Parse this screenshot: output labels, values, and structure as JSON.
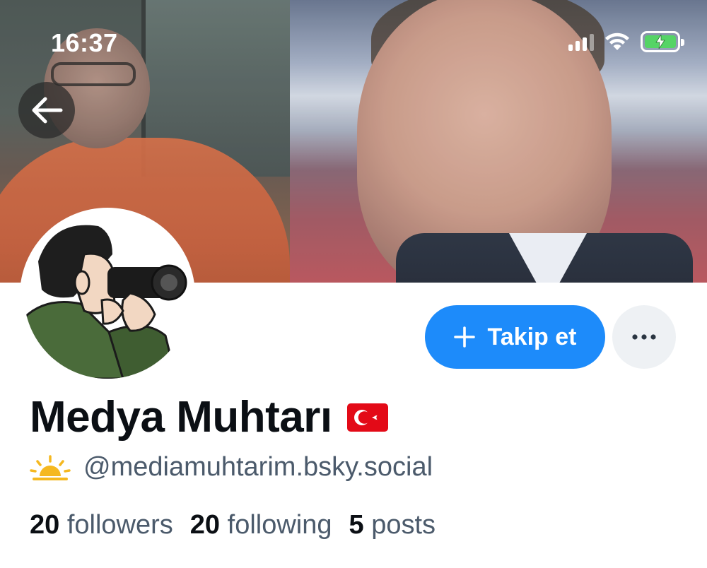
{
  "status_bar": {
    "time": "16:37",
    "signal_icon": "cellular-signal-icon",
    "wifi_icon": "wifi-icon",
    "battery_icon": "battery-charging-icon",
    "battery_color": "#55d466"
  },
  "header": {
    "back_icon": "arrow-left-icon"
  },
  "profile": {
    "display_name": "Medya Muhtarı",
    "flag_icon": "turkey-flag-icon",
    "status_icon": "sunrise-icon",
    "handle": "@mediamuhtarim.bsky.social",
    "follow_label": "Takip et",
    "follow_icon": "plus-icon",
    "more_icon": "ellipsis-icon",
    "accent_color": "#1d8bfa"
  },
  "stats": {
    "followers_count": "20",
    "followers_label": "followers",
    "following_count": "20",
    "following_label": "following",
    "posts_count": "5",
    "posts_label": "posts"
  }
}
